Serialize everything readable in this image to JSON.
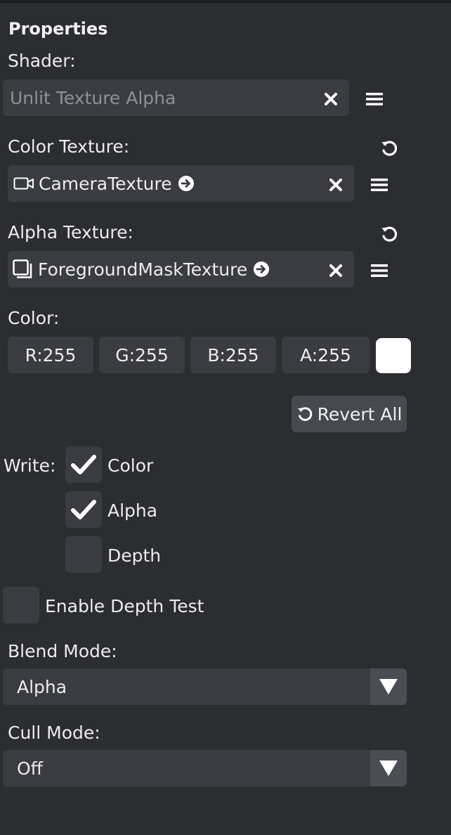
{
  "panel": {
    "title": "Properties"
  },
  "shader": {
    "label": "Shader:",
    "value": "Unlit Texture Alpha"
  },
  "color_texture": {
    "label": "Color Texture:",
    "value": "CameraTexture",
    "icon": "video-camera-icon"
  },
  "alpha_texture": {
    "label": "Alpha Texture:",
    "value": "ForegroundMaskTexture",
    "icon": "stacked-squares-icon"
  },
  "color": {
    "label": "Color:",
    "r": "R:255",
    "g": "G:255",
    "b": "B:255",
    "a": "A:255",
    "swatch_hex": "#ffffff"
  },
  "revert_all": {
    "label": "Revert All"
  },
  "write": {
    "label": "Write:",
    "options": [
      {
        "label": "Color",
        "checked": true
      },
      {
        "label": "Alpha",
        "checked": true
      },
      {
        "label": "Depth",
        "checked": false
      }
    ]
  },
  "depth_test": {
    "label": "Enable Depth Test",
    "checked": false
  },
  "blend_mode": {
    "label": "Blend Mode:",
    "value": "Alpha"
  },
  "cull_mode": {
    "label": "Cull Mode:",
    "value": "Off"
  },
  "colors": {
    "background": "#2b2d31",
    "field": "#3a3c41",
    "button": "#474950",
    "text": "#ececee",
    "placeholder": "#8f9196"
  }
}
